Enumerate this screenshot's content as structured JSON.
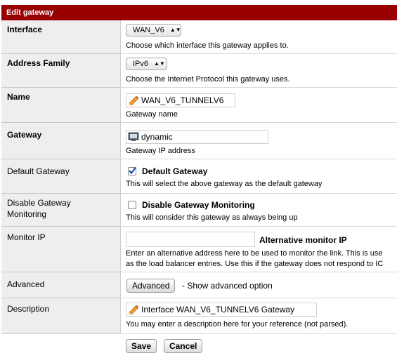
{
  "header": {
    "title": "Edit gateway"
  },
  "interface": {
    "label": "Interface",
    "value": "WAN_V6",
    "help": "Choose which interface this gateway applies to."
  },
  "address_family": {
    "label": "Address Family",
    "value": "IPv6",
    "help": "Choose the Internet Protocol this gateway uses."
  },
  "name": {
    "label": "Name",
    "value": "WAN_V6_TUNNELV6",
    "help": "Gateway name"
  },
  "gateway": {
    "label": "Gateway",
    "value": "dynamic",
    "help": "Gateway IP address"
  },
  "default_gateway": {
    "label": "Default Gateway",
    "checkbox_label": "Default Gateway",
    "checked": true,
    "help": "This will select the above gateway as the default gateway"
  },
  "disable_monitoring": {
    "label_line1": "Disable Gateway",
    "label_line2": "Monitoring",
    "checkbox_label": "Disable Gateway Monitoring",
    "checked": false,
    "help": "This will consider this gateway as always being up"
  },
  "monitor_ip": {
    "label": "Monitor IP",
    "value": "",
    "inline_label": "Alternative monitor IP",
    "help_line1": "Enter an alternative address here to be used to monitor the link. This is use",
    "help_line2": "as the load balancer entries. Use this if the gateway does not respond to IC"
  },
  "advanced": {
    "label": "Advanced",
    "button_label": "Advanced",
    "help": "- Show advanced option"
  },
  "description": {
    "label": "Description",
    "value": "Interface WAN_V6_TUNNELV6 Gateway",
    "help": "You may enter a description here for your reference (not parsed)."
  },
  "actions": {
    "save_label": "Save",
    "cancel_label": "Cancel"
  }
}
